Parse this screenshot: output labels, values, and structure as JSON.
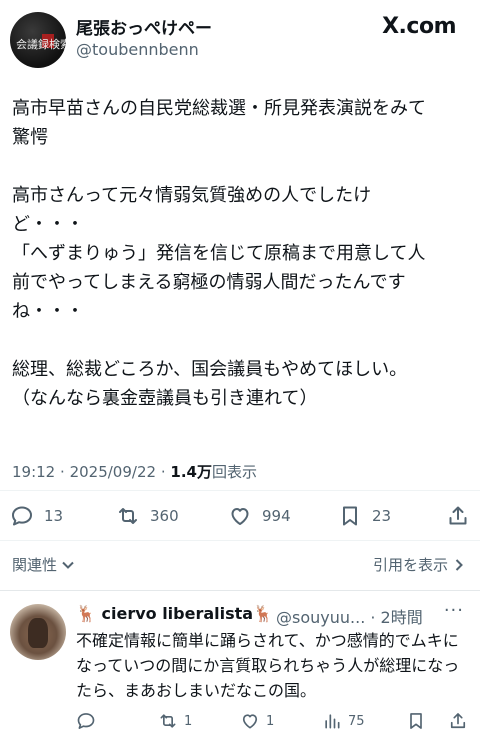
{
  "author": {
    "display_name": "尾張おっぺけペー",
    "handle": "@toubennbenn",
    "avatar_text": "会議録検索 補充"
  },
  "site_label": "X.com",
  "tweet": {
    "lines": [
      "高市早苗さんの自民党総裁選・所見発表演説をみて",
      "驚愕",
      "",
      "高市さんって元々情弱気質強めの人でしたけ",
      "ど・・・",
      "「へずまりゅう」発信を信じて原稿まで用意して人",
      "前でやってしまえる窮極の情弱人間だったんです",
      "ね・・・",
      "",
      "総理、総裁どころか、国会議員もやめてほしい。",
      "（なんなら裏金壺議員も引き連れて）"
    ],
    "time": "19:12",
    "sep": "·",
    "date": "2025/09/22",
    "views_count": "1.4万",
    "views_label": "回表示"
  },
  "actions": {
    "replies": "13",
    "reposts": "360",
    "likes": "994",
    "bookmarks": "23"
  },
  "filters": {
    "relevance_label": "関連性",
    "quotes_label": "引用を表示"
  },
  "reply": {
    "display_name": "🦌 ciervo liberalista🦌",
    "handle_time": "@souyuu... · 2時間",
    "more": "···",
    "text": "不確定情報に簡単に踊らされて、かつ感情的でムキになっていつの間にか言質取られちゃう人が総理になったら、まあおしまいだなこの国。",
    "replies": "",
    "reposts": "1",
    "likes": "1",
    "views": "75"
  }
}
